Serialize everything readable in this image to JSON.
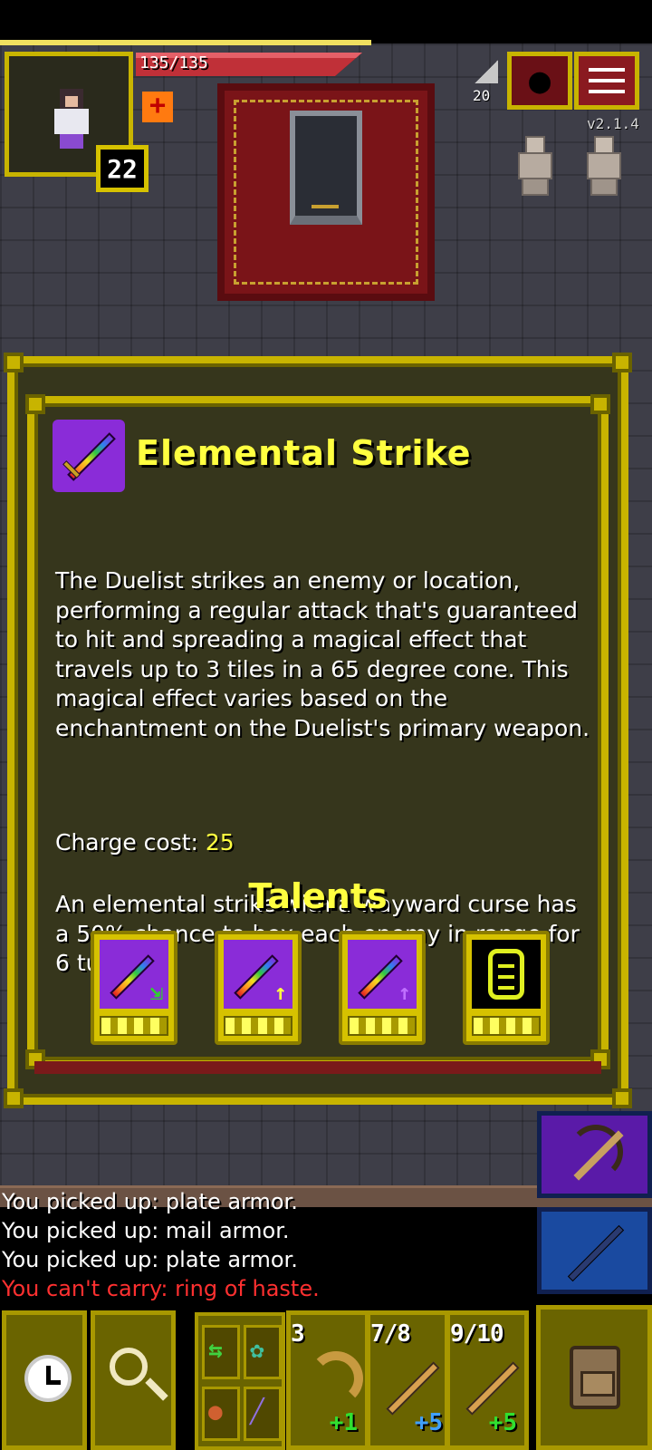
{
  "hud": {
    "hp_text": "135/135",
    "hp_fraction": 1.0,
    "hero_level": "22",
    "depth": "20",
    "version": "v2.1.4"
  },
  "window": {
    "title": "Elemental Strike",
    "description_p1": "The Duelist strikes an enemy or location,\nperforming a regular attack that's guaranteed\nto hit and spreading a magical effect that\ntravels up to 3 tiles in a 65 degree cone. This\nmagical effect varies based on the\nenchantment on the Duelist's primary weapon.",
    "description_p2": "An elemental strike with a wayward curse has\na 50% chance to hex each enemy in range for\n6 turns.",
    "charge_label": "Charge cost: ",
    "charge_value": "25",
    "talents_title": "Talents",
    "talents": [
      {
        "icon": "elemental-strike-range-icon",
        "points": 0,
        "max_points": 4
      },
      {
        "icon": "elemental-strike-power-up-icon",
        "points": 0,
        "max_points": 4
      },
      {
        "icon": "elemental-strike-arcane-up-icon",
        "points": 0,
        "max_points": 4
      },
      {
        "icon": "armor-vest-icon",
        "points": 0,
        "max_points": 4
      }
    ]
  },
  "log": [
    {
      "text": "You picked up: plate armor.",
      "type": "normal"
    },
    {
      "text": "You picked up: mail armor.",
      "type": "normal"
    },
    {
      "text": "You picked up: plate armor.",
      "type": "normal"
    },
    {
      "text": "You can't carry: ring of haste.",
      "type": "warning"
    }
  ],
  "quickslots": [
    {
      "count": "3",
      "bonus": "+1",
      "icon": "boomerang-icon"
    },
    {
      "count": "7/8",
      "bonus": "+5",
      "icon": "javelin-icon"
    },
    {
      "count": "9/10",
      "bonus": "+5",
      "icon": "dart-icon"
    }
  ],
  "colors": {
    "accent_gold": "#c8b400",
    "title_yellow": "#ffff40",
    "warning_red": "#ff3030",
    "hp_red": "#c03038"
  }
}
